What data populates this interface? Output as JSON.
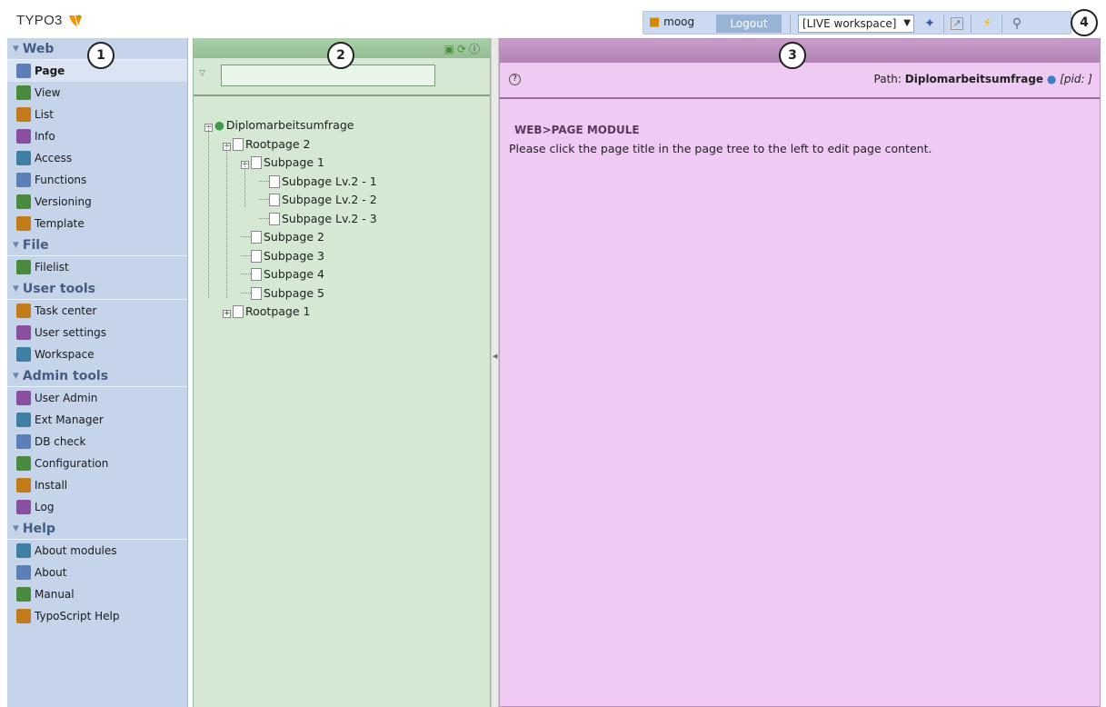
{
  "app": {
    "logo_text": "TYPO3"
  },
  "topbar": {
    "user": "moog",
    "logout_label": "Logout",
    "workspace": "[LIVE workspace]",
    "icons": [
      "workspace-brush-icon",
      "external-link-icon",
      "flash-clear-cache-icon",
      "search-icon"
    ]
  },
  "callouts": [
    "1",
    "2",
    "3",
    "4"
  ],
  "nav": {
    "sections": [
      {
        "title": "Web",
        "items": [
          {
            "label": "Page",
            "icon": "page-edit-icon",
            "active": true
          },
          {
            "label": "View",
            "icon": "magnifier-icon"
          },
          {
            "label": "List",
            "icon": "list-icon"
          },
          {
            "label": "Info",
            "icon": "info-icon"
          },
          {
            "label": "Access",
            "icon": "lock-icon"
          },
          {
            "label": "Functions",
            "icon": "wand-icon"
          },
          {
            "label": "Versioning",
            "icon": "versioning-icon"
          },
          {
            "label": "Template",
            "icon": "template-icon"
          }
        ]
      },
      {
        "title": "File",
        "items": [
          {
            "label": "Filelist",
            "icon": "folder-icon"
          }
        ]
      },
      {
        "title": "User tools",
        "items": [
          {
            "label": "Task center",
            "icon": "task-center-icon"
          },
          {
            "label": "User settings",
            "icon": "user-settings-icon"
          },
          {
            "label": "Workspace",
            "icon": "workspace-icon"
          }
        ]
      },
      {
        "title": "Admin tools",
        "items": [
          {
            "label": "User Admin",
            "icon": "user-admin-icon"
          },
          {
            "label": "Ext Manager",
            "icon": "ext-manager-icon"
          },
          {
            "label": "DB check",
            "icon": "db-check-icon"
          },
          {
            "label": "Configuration",
            "icon": "configuration-icon"
          },
          {
            "label": "Install",
            "icon": "install-icon"
          },
          {
            "label": "Log",
            "icon": "log-icon"
          }
        ]
      },
      {
        "title": "Help",
        "items": [
          {
            "label": "About modules",
            "icon": "about-modules-icon"
          },
          {
            "label": "About",
            "icon": "about-icon"
          },
          {
            "label": "Manual",
            "icon": "manual-icon"
          },
          {
            "label": "TypoScript Help",
            "icon": "typoscript-help-icon"
          }
        ]
      }
    ]
  },
  "tree": {
    "filter_value": "",
    "nodes": [
      {
        "label": "Diplomarbeitsumfrage",
        "depth": 0,
        "toggle": "minus",
        "icon": "globe-icon"
      },
      {
        "label": "Rootpage 2",
        "depth": 1,
        "toggle": "minus",
        "icon": "page-shortcut-icon"
      },
      {
        "label": "Subpage 1",
        "depth": 2,
        "toggle": "minus",
        "icon": "page-icon"
      },
      {
        "label": "Subpage Lv.2 - 1",
        "depth": 3,
        "toggle": "",
        "icon": "page-icon"
      },
      {
        "label": "Subpage Lv.2 - 2",
        "depth": 3,
        "toggle": "",
        "icon": "page-icon"
      },
      {
        "label": "Subpage Lv.2 - 3",
        "depth": 3,
        "toggle": "",
        "icon": "page-icon"
      },
      {
        "label": "Subpage 2",
        "depth": 2,
        "toggle": "",
        "icon": "page-icon"
      },
      {
        "label": "Subpage 3",
        "depth": 2,
        "toggle": "",
        "icon": "page-icon"
      },
      {
        "label": "Subpage 4",
        "depth": 2,
        "toggle": "",
        "icon": "page-icon"
      },
      {
        "label": "Subpage 5",
        "depth": 2,
        "toggle": "",
        "icon": "page-icon"
      },
      {
        "label": "Rootpage 1",
        "depth": 1,
        "toggle": "plus",
        "icon": "page-shortcut-icon"
      }
    ]
  },
  "content": {
    "path_label": "Path:",
    "path_value": "Diplomarbeitsumfrage",
    "pid_label": "[pid: ]",
    "module_title": "WEB>PAGE MODULE",
    "message": "Please click the page title in the page tree to the left to edit page content."
  }
}
